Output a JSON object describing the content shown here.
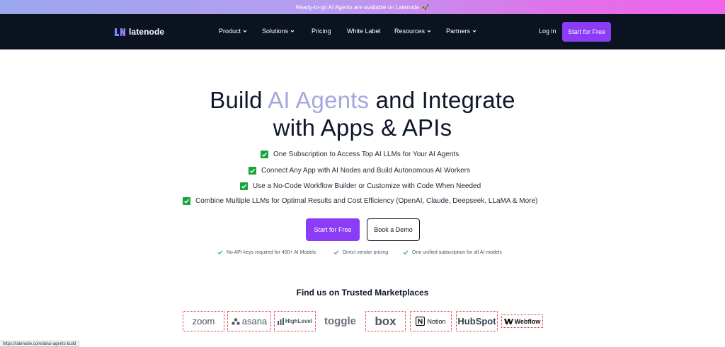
{
  "announcement": {
    "text": "Ready-to-go AI Agents are available on Latenode",
    "emoji": "🚀"
  },
  "brand": {
    "name": "latenode"
  },
  "nav": {
    "items": [
      {
        "label": "Product",
        "has_dropdown": true
      },
      {
        "label": "Solutions",
        "has_dropdown": true
      },
      {
        "label": "Pricing",
        "has_dropdown": false
      },
      {
        "label": "White Label",
        "has_dropdown": false
      },
      {
        "label": "Resources",
        "has_dropdown": true
      },
      {
        "label": "Partners",
        "has_dropdown": true
      }
    ],
    "login": "Log in",
    "cta": "Start for Free"
  },
  "hero": {
    "title_part1": "Build ",
    "title_highlight": "AI Agents",
    "title_part2": " and Integrate",
    "title_line2": "with Apps & APIs",
    "features": [
      "One Subscription to Access Top AI LLMs for Your AI Agents",
      "Connect Any App with AI Nodes and Build Autonomous AI Workers",
      "Use a No-Code Workflow Builder or Customize with Code When Needed",
      "Combine Multiple LLMs for Optimal Results and Cost Efficiency (OpenAI, Claude, Deepseek, LLaMA & More)"
    ],
    "primary_cta": "Start for Free",
    "secondary_cta": "Book a Demo",
    "perks": [
      "No API keys required for 400+ AI Models",
      "Direct vendor pricing",
      "One unified subscription for all AI models"
    ]
  },
  "marketplaces": {
    "title": "Find us on Trusted Marketplaces",
    "brands": [
      "zoom",
      "asana",
      "HighLevel",
      "toggle",
      "box",
      "Notion",
      "HubSpot",
      "Webflow"
    ]
  },
  "status_url": "https://latenode.com/ab/ai-agents-build",
  "colors": {
    "accent": "#8b3cf6",
    "nav_bg": "#0b1220",
    "highlight": "#a5a8de",
    "check": "#19a33b",
    "marketplace_border": "#e0242e"
  }
}
